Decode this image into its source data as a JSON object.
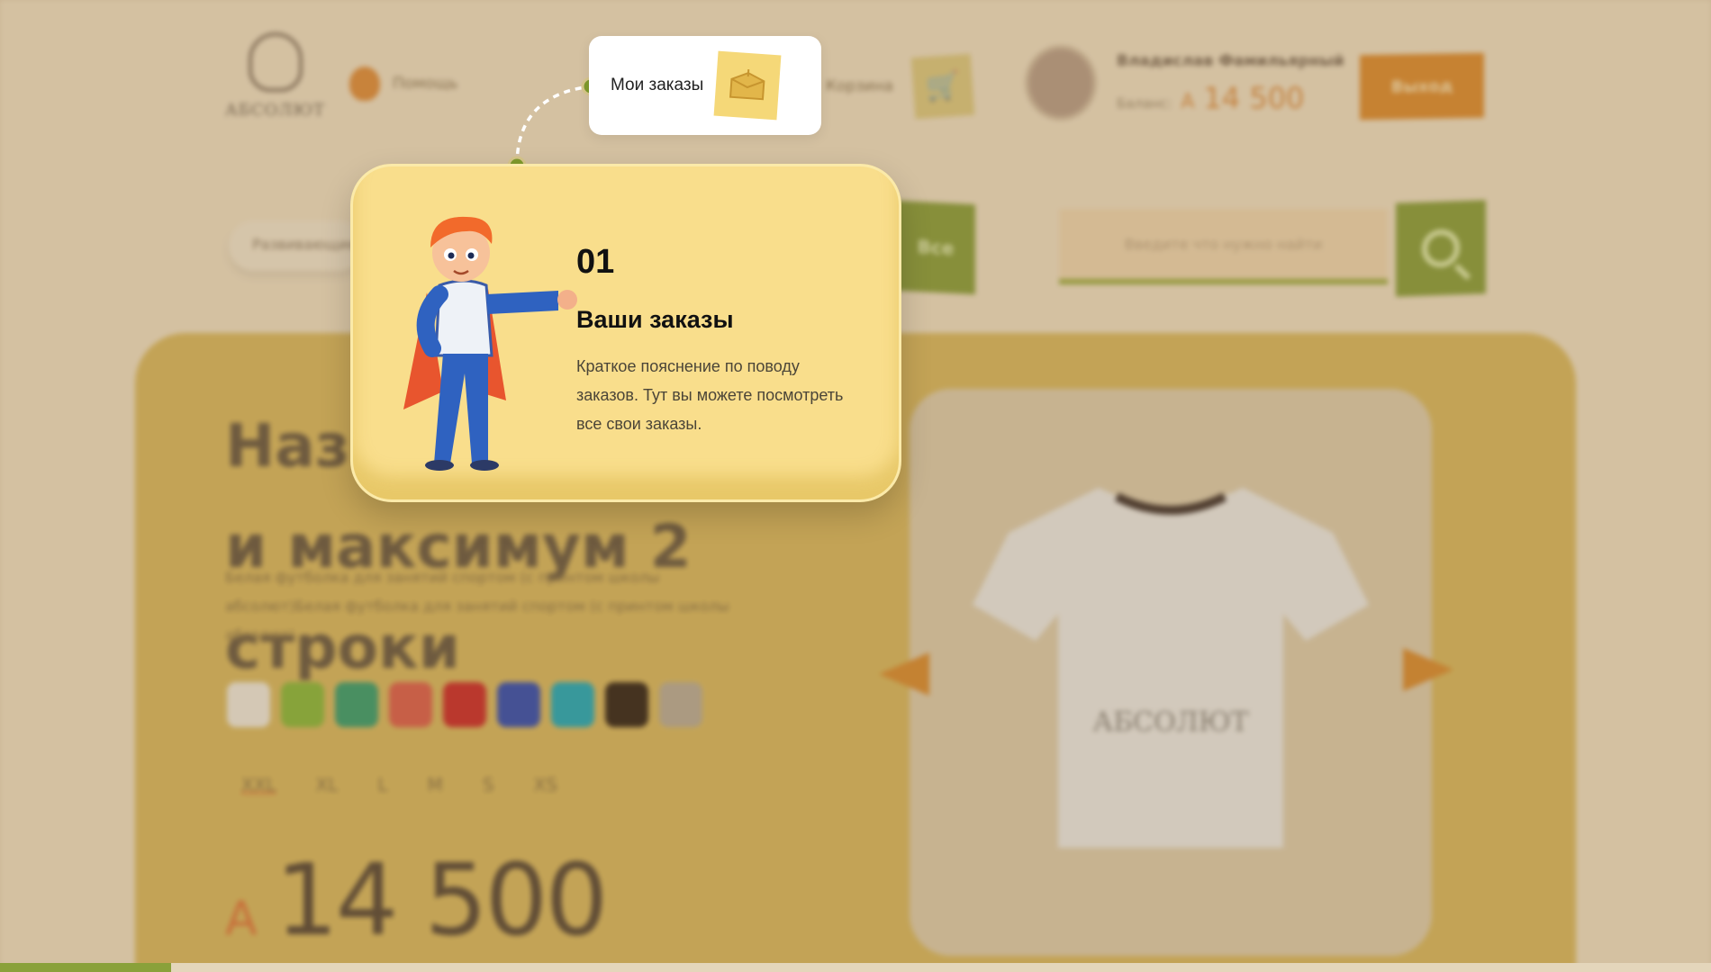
{
  "header": {
    "logo_text": "АБСОЛЮТ",
    "help_label": "Помощь",
    "cart_label": "Корзина",
    "user_name": "Владислав Фамильярный",
    "balance_label": "Баланс:",
    "balance_currency": "A",
    "balance_value": "14 500",
    "logout_label": "Выход"
  },
  "search": {
    "category_label": "Развивающие",
    "all_label": "Все",
    "placeholder": "Введите что нужно найти"
  },
  "product": {
    "title": "Название товара и максимум 2 строки",
    "description": "Белая футболка для занятий спортом (с принтом школы абсолют)Белая футболка для занятий спортом (с принтом школы абсолют)",
    "swatches": [
      "#e8e0d0",
      "#8ab23a",
      "#3f9a6a",
      "#d8604a",
      "#c8302a",
      "#3a4fa8",
      "#2aa5b0",
      "#3a2a1a",
      "#b6a890"
    ],
    "sizes": [
      "XXL",
      "XL",
      "L",
      "M",
      "S",
      "XS"
    ],
    "price_currency": "A",
    "price_value": "14 500",
    "tshirt_print": "АБСОЛЮТ"
  },
  "onboarding": {
    "highlight_label": "Мои заказы",
    "step": "01",
    "title": "Ваши заказы",
    "text": "Краткое пояснение по поводу заказов. Тут  вы можете посмотреть все свои заказы.",
    "progress": 0.1
  },
  "colors": {
    "accent_green": "#8aa13a",
    "accent_orange": "#d78a30",
    "tooltip_bg": "#f9de8c"
  }
}
